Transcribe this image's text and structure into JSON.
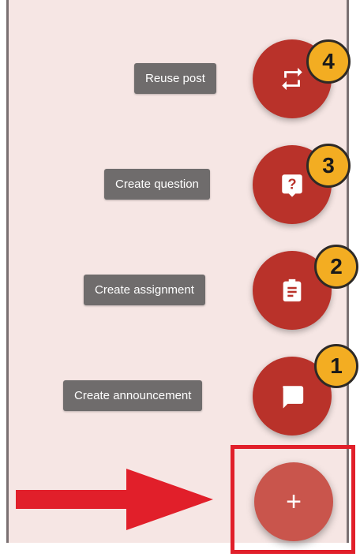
{
  "speed_dial": {
    "actions": [
      {
        "label": "Reuse post",
        "badge": "4",
        "icon": "repeat-icon"
      },
      {
        "label": "Create question",
        "badge": "3",
        "icon": "question-icon"
      },
      {
        "label": "Create assignment",
        "badge": "2",
        "icon": "clipboard-icon"
      },
      {
        "label": "Create announcement",
        "badge": "1",
        "icon": "chat-bubble-icon"
      }
    ],
    "main_button": {
      "label": "+",
      "icon": "plus-icon"
    }
  },
  "annotation": {
    "arrow_color": "#e11f2a",
    "badge_color": "#f3ad22",
    "fab_color": "#b9322a"
  }
}
